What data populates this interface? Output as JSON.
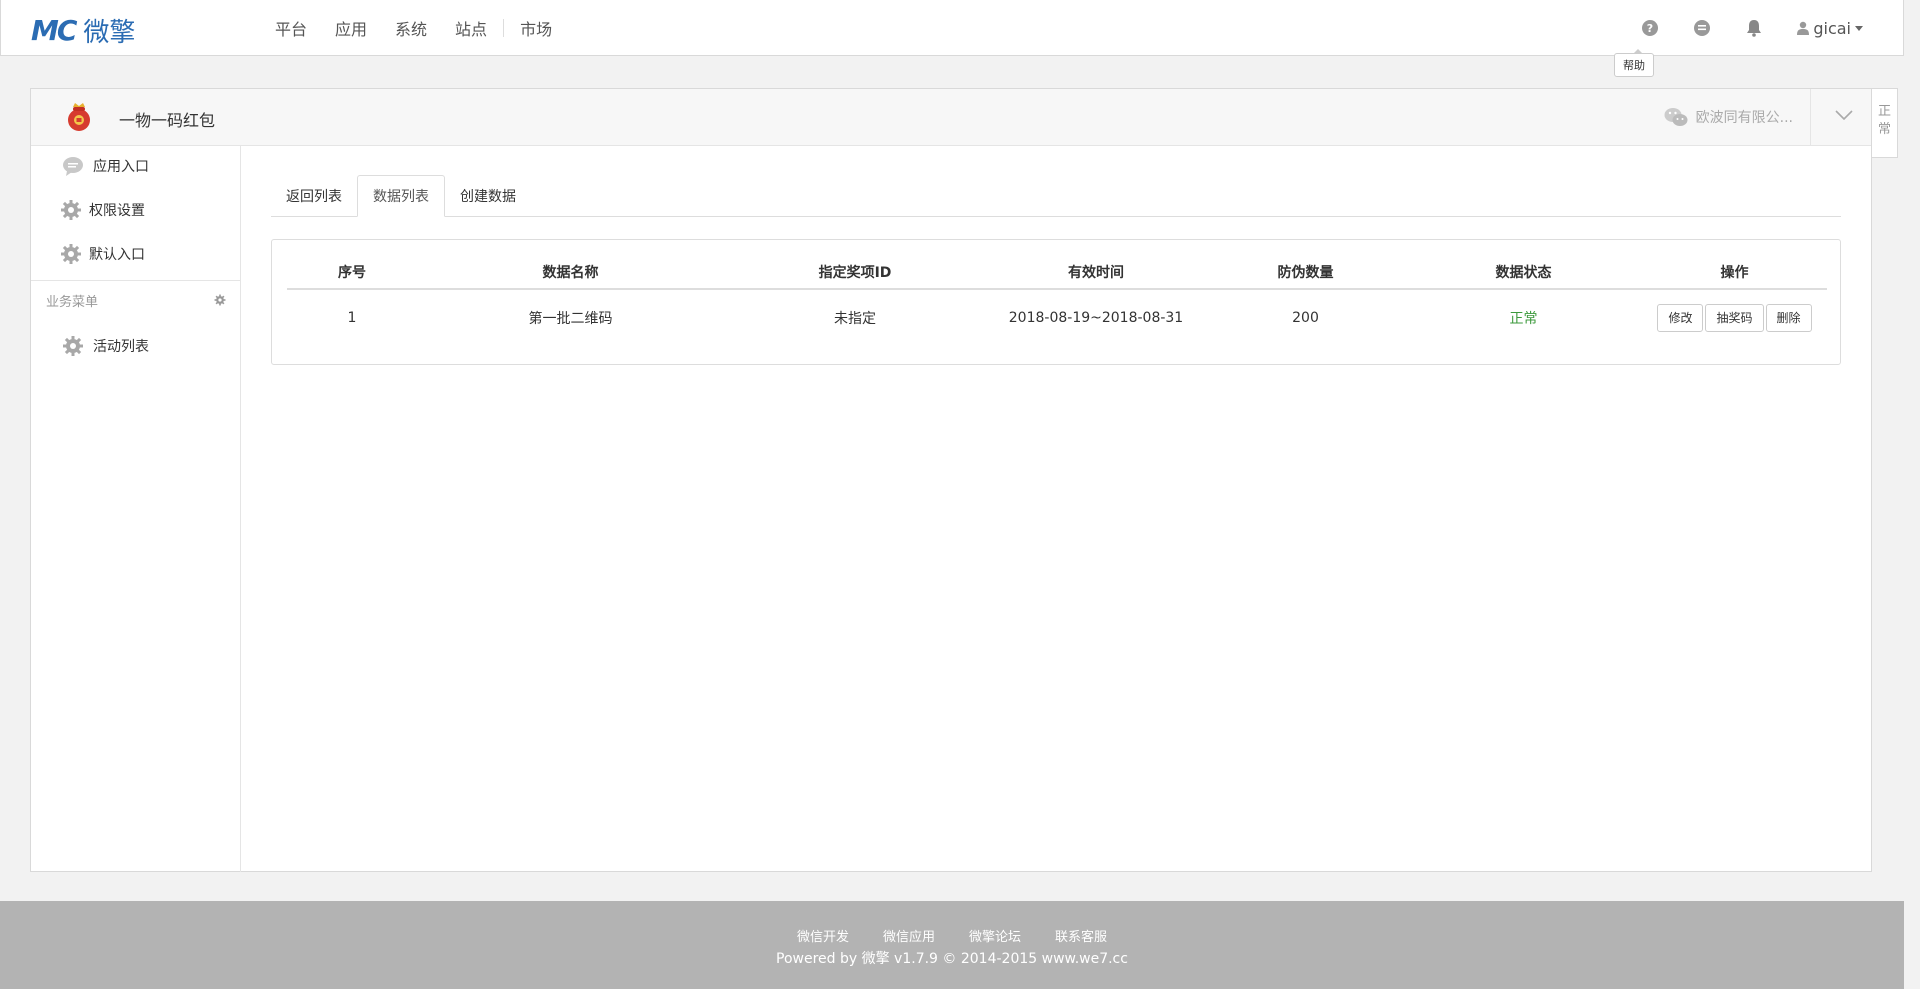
{
  "brand": {
    "logo_mark": "MC",
    "logo_text": "微擎"
  },
  "nav": {
    "items": [
      "平台",
      "应用",
      "系统",
      "站点"
    ],
    "market": "市场"
  },
  "topbar": {
    "username": "gicai",
    "help_tooltip": "帮助"
  },
  "app": {
    "title": "一物一码红包",
    "account_name": "欧波同有限公...",
    "side_tab": "正常"
  },
  "sidebar": {
    "items": [
      "应用入口",
      "权限设置",
      "默认入口"
    ],
    "group_title": "业务菜单",
    "group_items": [
      "活动列表"
    ]
  },
  "tabs": [
    "返回列表",
    "数据列表",
    "创建数据"
  ],
  "table": {
    "headers": [
      "序号",
      "数据名称",
      "指定奖项ID",
      "有效时间",
      "防伪数量",
      "数据状态",
      "操作"
    ],
    "rows": [
      {
        "index": "1",
        "name": "第一批二维码",
        "prize_id": "未指定",
        "valid_time": "2018-08-19~2018-08-31",
        "quantity": "200",
        "status": "正常",
        "actions": [
          "修改",
          "抽奖码",
          "删除"
        ]
      }
    ]
  },
  "footer": {
    "links": [
      "微信开发",
      "微信应用",
      "微擎论坛",
      "联系客服"
    ],
    "powered": "Powered by 微擎 v1.7.9 © 2014-2015 www.we7.cc"
  },
  "colors": {
    "brand": "#2b6cb3",
    "status_ok": "#3c9a3c",
    "footer_bg": "#b3b3b3"
  }
}
